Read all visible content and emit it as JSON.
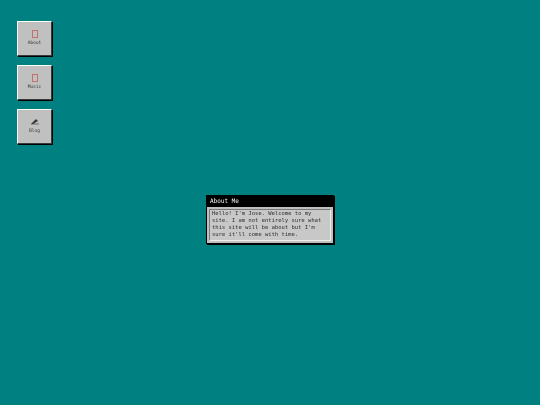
{
  "desktop": {
    "background": "#008080",
    "icons": [
      {
        "label": "About",
        "icon": "document-icon"
      },
      {
        "label": "Music",
        "icon": "music-note-icon"
      },
      {
        "label": "Blog",
        "icon": "pencil-icon"
      }
    ]
  },
  "window": {
    "title": "About Me",
    "body": "Hello! I'm Jose. Welcome to my site. I am not entirely sure what this site will be about but I'm sure it'll come with time."
  }
}
